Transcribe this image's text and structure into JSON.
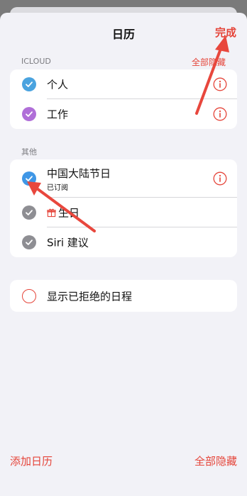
{
  "nav": {
    "title": "日历",
    "done_label": "完成"
  },
  "icloud": {
    "section_label": "ICLOUD",
    "action_label": "全部隐藏",
    "items": [
      {
        "label": "个人",
        "checked": true,
        "color": "#4aa3df"
      },
      {
        "label": "工作",
        "checked": true,
        "color": "#b06fd8"
      }
    ]
  },
  "other": {
    "section_label": "其他",
    "items": [
      {
        "label": "中国大陆节日",
        "sublabel": "已订阅",
        "checked": true,
        "color": "#3f97e6"
      },
      {
        "label": "生日",
        "checked": true,
        "color": "#8e8e93",
        "icon": "gift-icon"
      },
      {
        "label": "Siri 建议",
        "checked": true,
        "color": "#8e8e93"
      }
    ]
  },
  "declined": {
    "label": "显示已拒绝的日程",
    "checked": false
  },
  "footer": {
    "add_label": "添加日历",
    "hide_all_label": "全部隐藏"
  },
  "colors": {
    "accent": "#e5453a",
    "background": "#f2f2f7"
  }
}
